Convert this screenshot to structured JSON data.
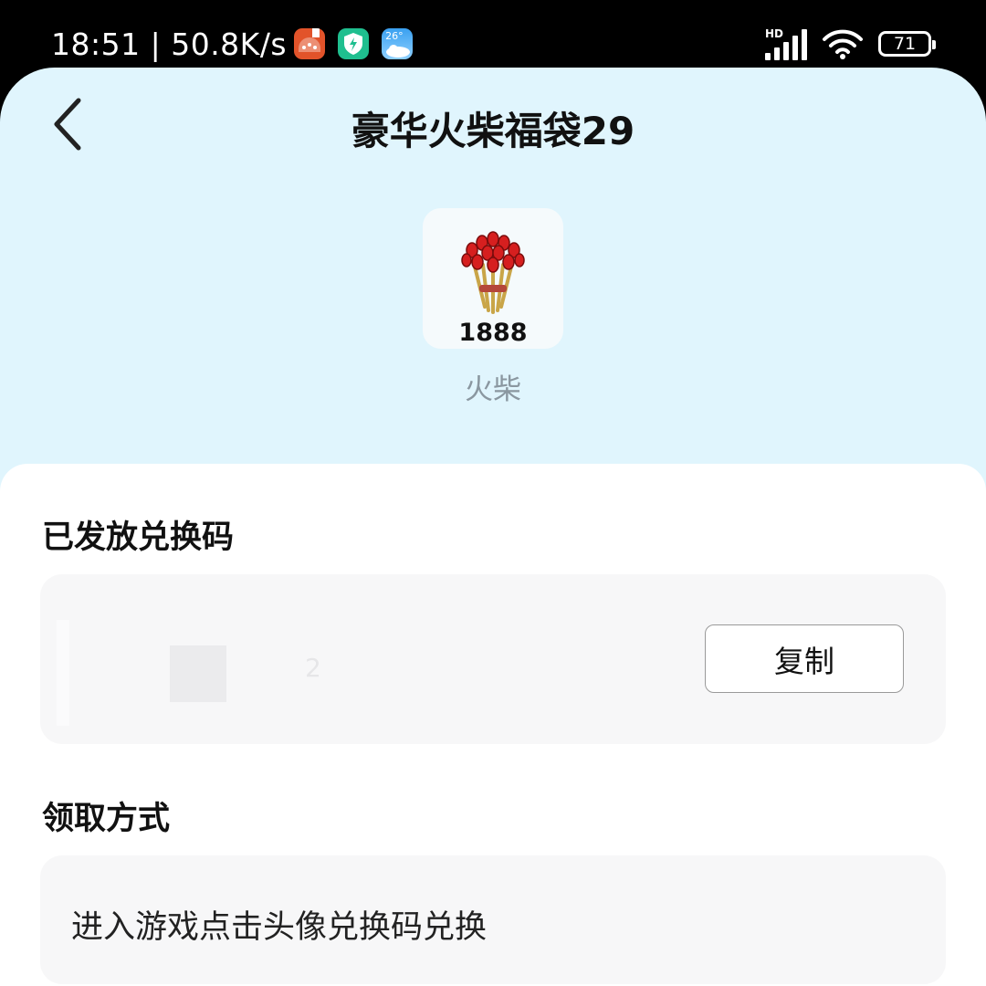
{
  "status_bar": {
    "time_speed": "18:51 | 50.8K/s",
    "weather_temp": "26°",
    "network_label": "HD",
    "battery_level": "71"
  },
  "header": {
    "title": "豪华火柴福袋29",
    "back_icon": "chevron-left-icon"
  },
  "gift": {
    "icon": "matches-bundle-icon",
    "count": "1888",
    "name": "火柴"
  },
  "code_section": {
    "title": "已发放兑换码",
    "code_value": "2",
    "copy_label": "复制"
  },
  "method_section": {
    "title": "领取方式",
    "text": "进入游戏点击头像兑换码兑换"
  },
  "colors": {
    "header_bg": "#e0f5fd",
    "card_bg": "#f7f7f8",
    "muted_text": "#8a97a0"
  }
}
